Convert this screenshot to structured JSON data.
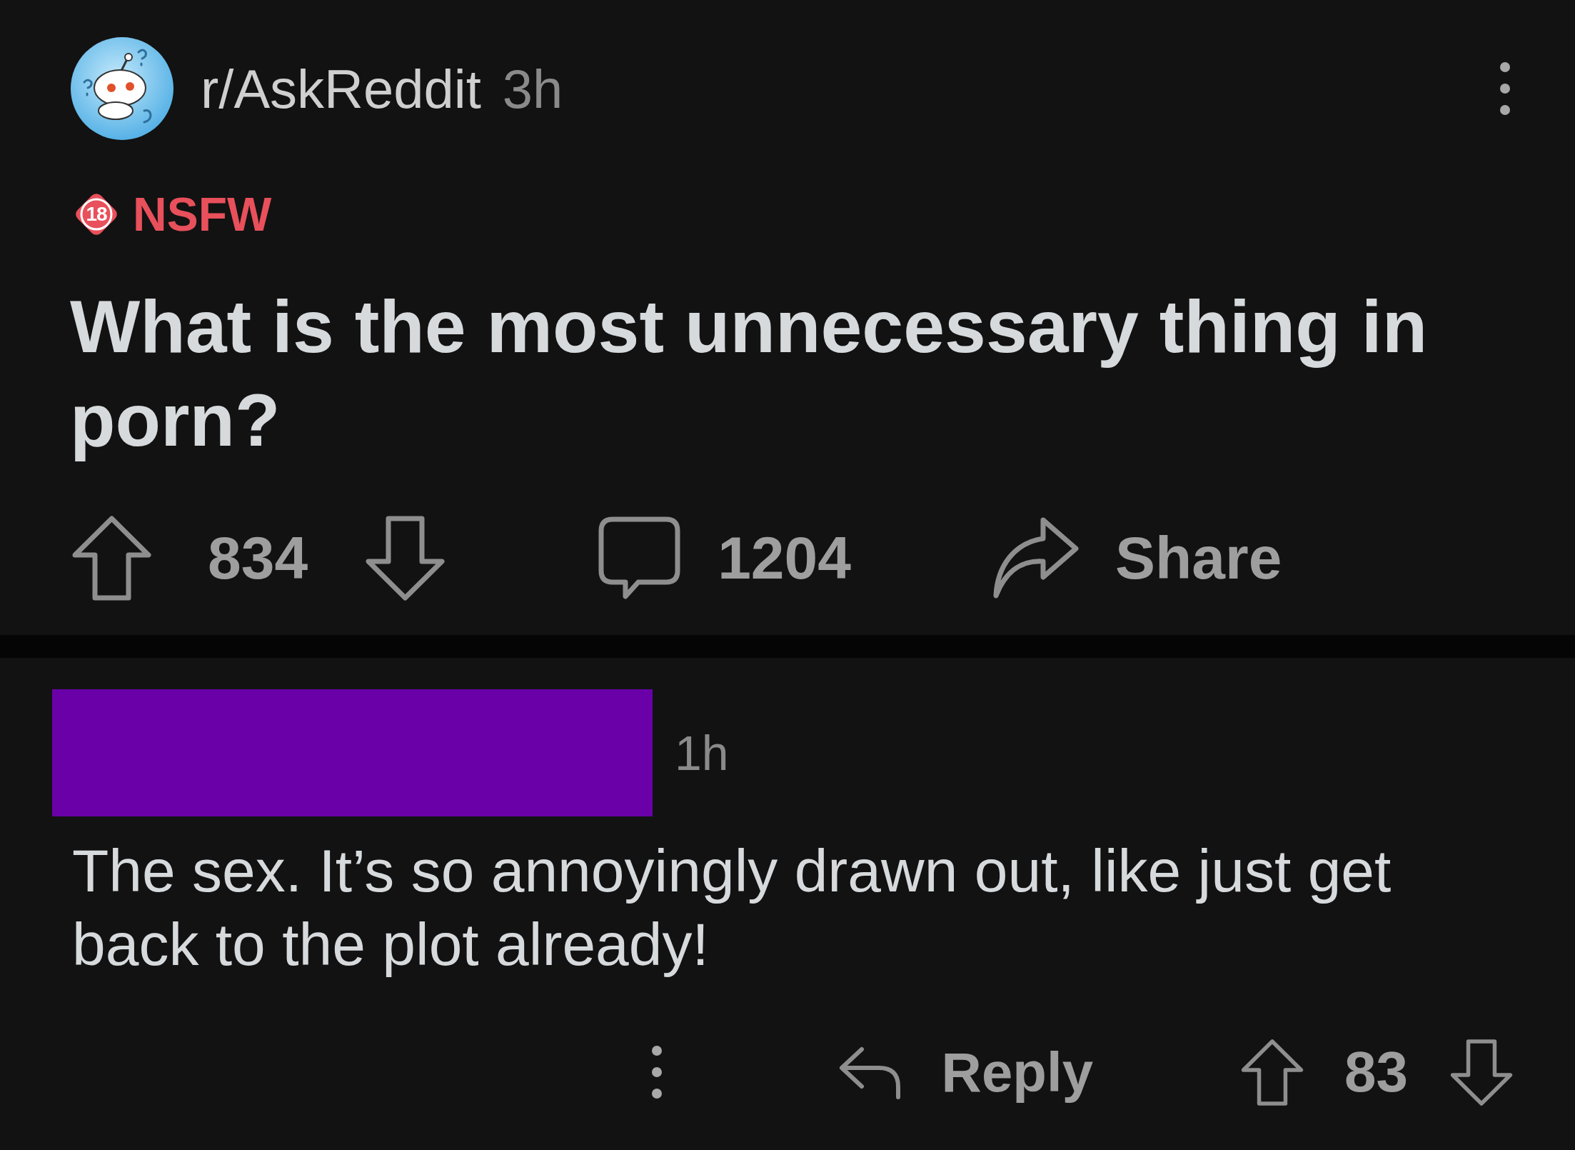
{
  "post": {
    "subreddit": "r/AskReddit",
    "age": "3h",
    "nsfw": {
      "badge": "18",
      "label": "NSFW"
    },
    "title": "What is the most unnecessary thing in porn?",
    "votes": "834",
    "comments": "1204",
    "share": "Share"
  },
  "comment": {
    "age": "1h",
    "body": "The sex. It’s so annoyingly drawn out, like just get back to the plot already!",
    "reply": "Reply",
    "votes": "83"
  }
}
